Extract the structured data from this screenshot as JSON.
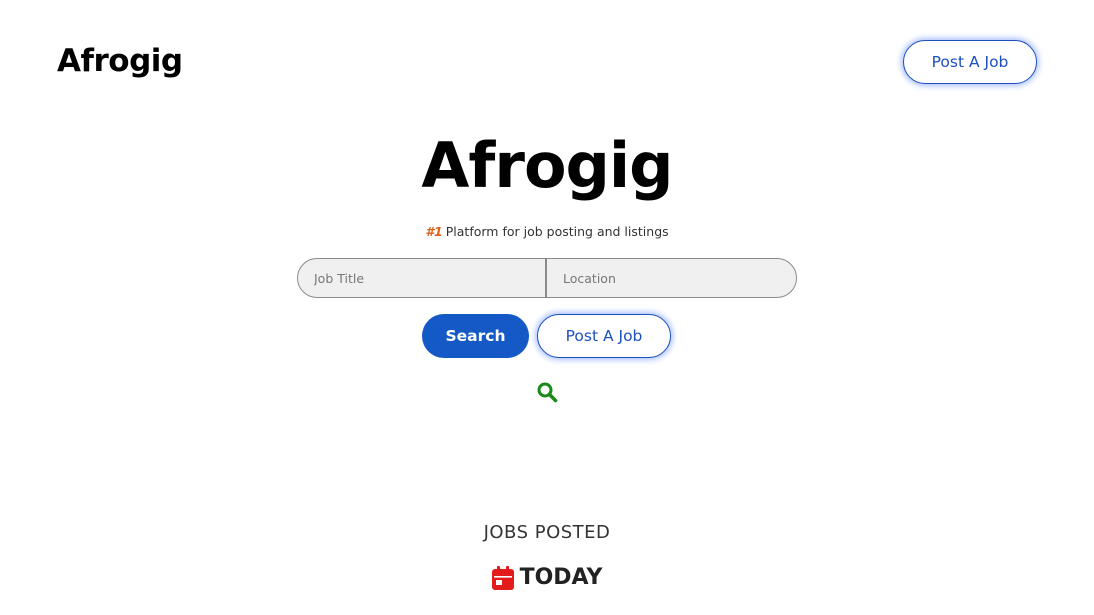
{
  "header": {
    "logo": "Afrogig",
    "post_job_label": "Post A Job"
  },
  "hero": {
    "title": "Afrogig",
    "tagline_rank": "#1",
    "tagline_text": "Platform for job posting and listings",
    "search": {
      "job_title_placeholder": "Job Title",
      "location_placeholder": "Location",
      "search_label": "Search",
      "post_job_label": "Post A Job"
    },
    "search_icon": "search-icon"
  },
  "stats": {
    "heading": "JOBS POSTED",
    "period_icon": "calendar-icon",
    "period_label": "TODAY"
  },
  "colors": {
    "primary": "#1459c6",
    "outline": "#1d4fbf",
    "rank": "#e2621b",
    "search_icon": "#1a8a1a",
    "calendar_icon": "#e31b1b"
  }
}
